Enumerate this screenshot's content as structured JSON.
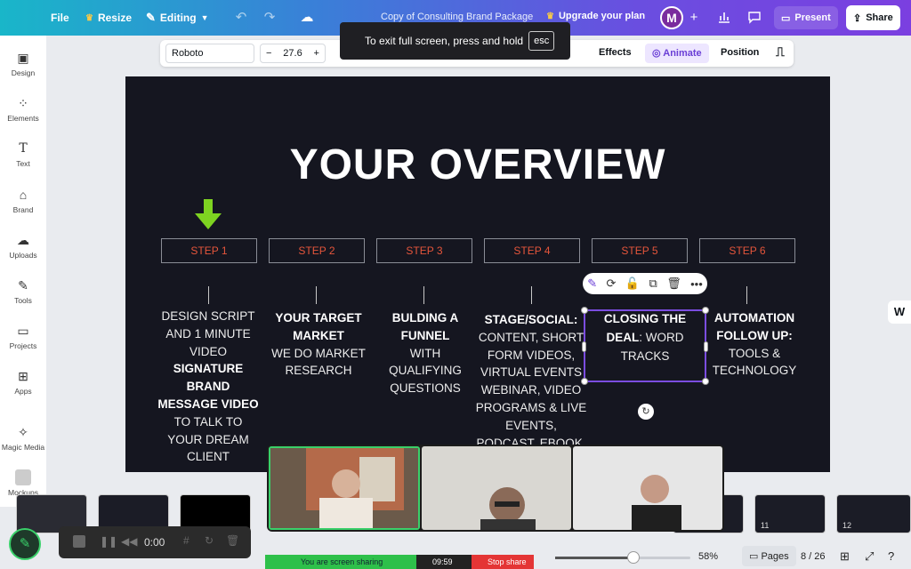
{
  "topbar": {
    "file": "File",
    "resize": "Resize",
    "editing": "Editing",
    "doc_title": "Copy of Consulting Brand Package",
    "upgrade": "Upgrade your plan",
    "avatar_initial": "M",
    "present": "Present",
    "share": "Share"
  },
  "toolbar": {
    "font": "Roboto",
    "minus": "−",
    "font_size": "27.6",
    "plus": "+",
    "effects": "Effects",
    "animate": "Animate",
    "position": "Position"
  },
  "tooltip": {
    "text": "To exit full screen, press and hold",
    "key": "esc"
  },
  "sidebar": {
    "items": [
      {
        "label": "Design",
        "icon": "design-icon"
      },
      {
        "label": "Elements",
        "icon": "elements-icon"
      },
      {
        "label": "Text",
        "icon": "text-icon"
      },
      {
        "label": "Brand",
        "icon": "brand-icon"
      },
      {
        "label": "Uploads",
        "icon": "uploads-icon"
      },
      {
        "label": "Tools",
        "icon": "tools-icon"
      },
      {
        "label": "Projects",
        "icon": "projects-icon"
      },
      {
        "label": "Apps",
        "icon": "apps-icon"
      },
      {
        "label": "Magic Media",
        "icon": "magic-media-icon"
      },
      {
        "label": "Mockups",
        "icon": "mockups-icon"
      }
    ]
  },
  "slide": {
    "title": "YOUR OVERVIEW",
    "accent_color": "#e5553b",
    "arrow_color": "#7ed321",
    "steps": [
      "STEP 1",
      "STEP 2",
      "STEP 3",
      "STEP 4",
      "STEP 5",
      "STEP 6"
    ]
  },
  "bottom": {
    "thumb_11": "11",
    "thumb_12": "12",
    "rec_time": "0:00",
    "sharing_text": "You are screen sharing",
    "timer": "09:59",
    "stop": "Stop share",
    "zoom": "58%",
    "zoom_level": 0.58,
    "pages": "Pages",
    "page_count": "8 / 26"
  }
}
